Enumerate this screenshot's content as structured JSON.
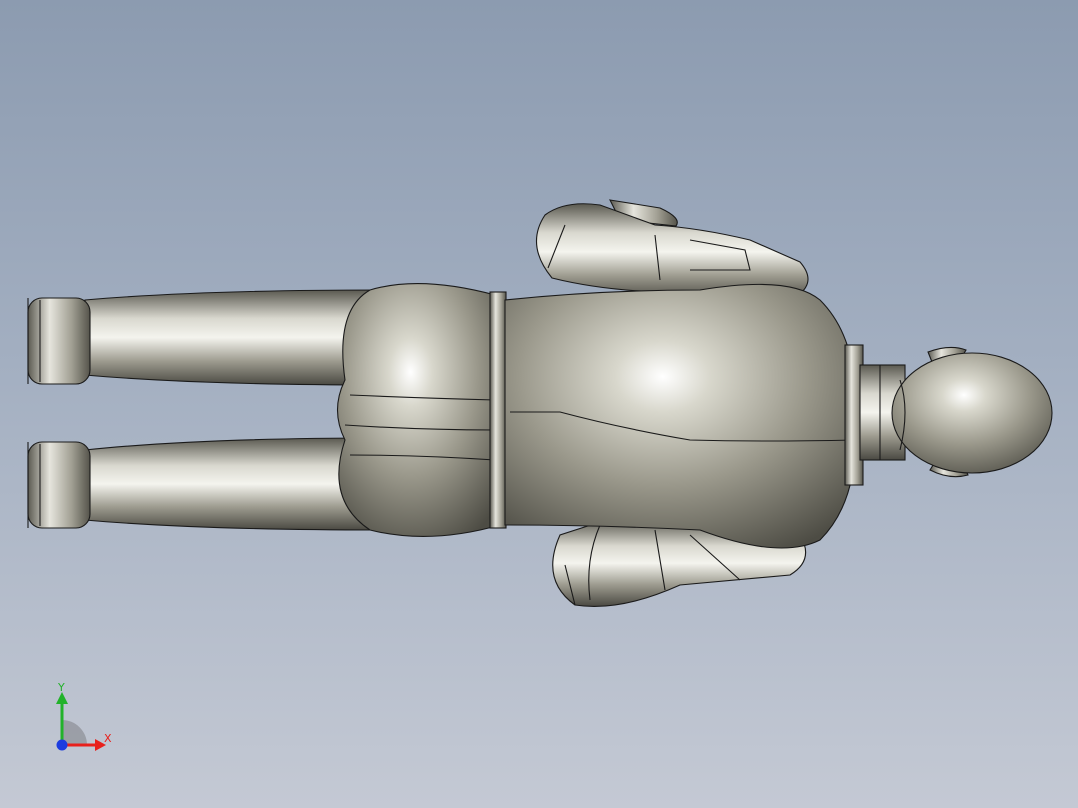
{
  "viewport": {
    "background_top": "#8c9bb0",
    "background_bottom": "#c4c9d4"
  },
  "model": {
    "part": "dummy-figure",
    "surface_color": "#9c9a8e",
    "edge_color": "#1a1a1a"
  },
  "triad": {
    "x_label": "X",
    "y_label": "Y",
    "x_color": "#e8201c",
    "y_color": "#22b22a",
    "z_color": "#1c3ce0"
  }
}
